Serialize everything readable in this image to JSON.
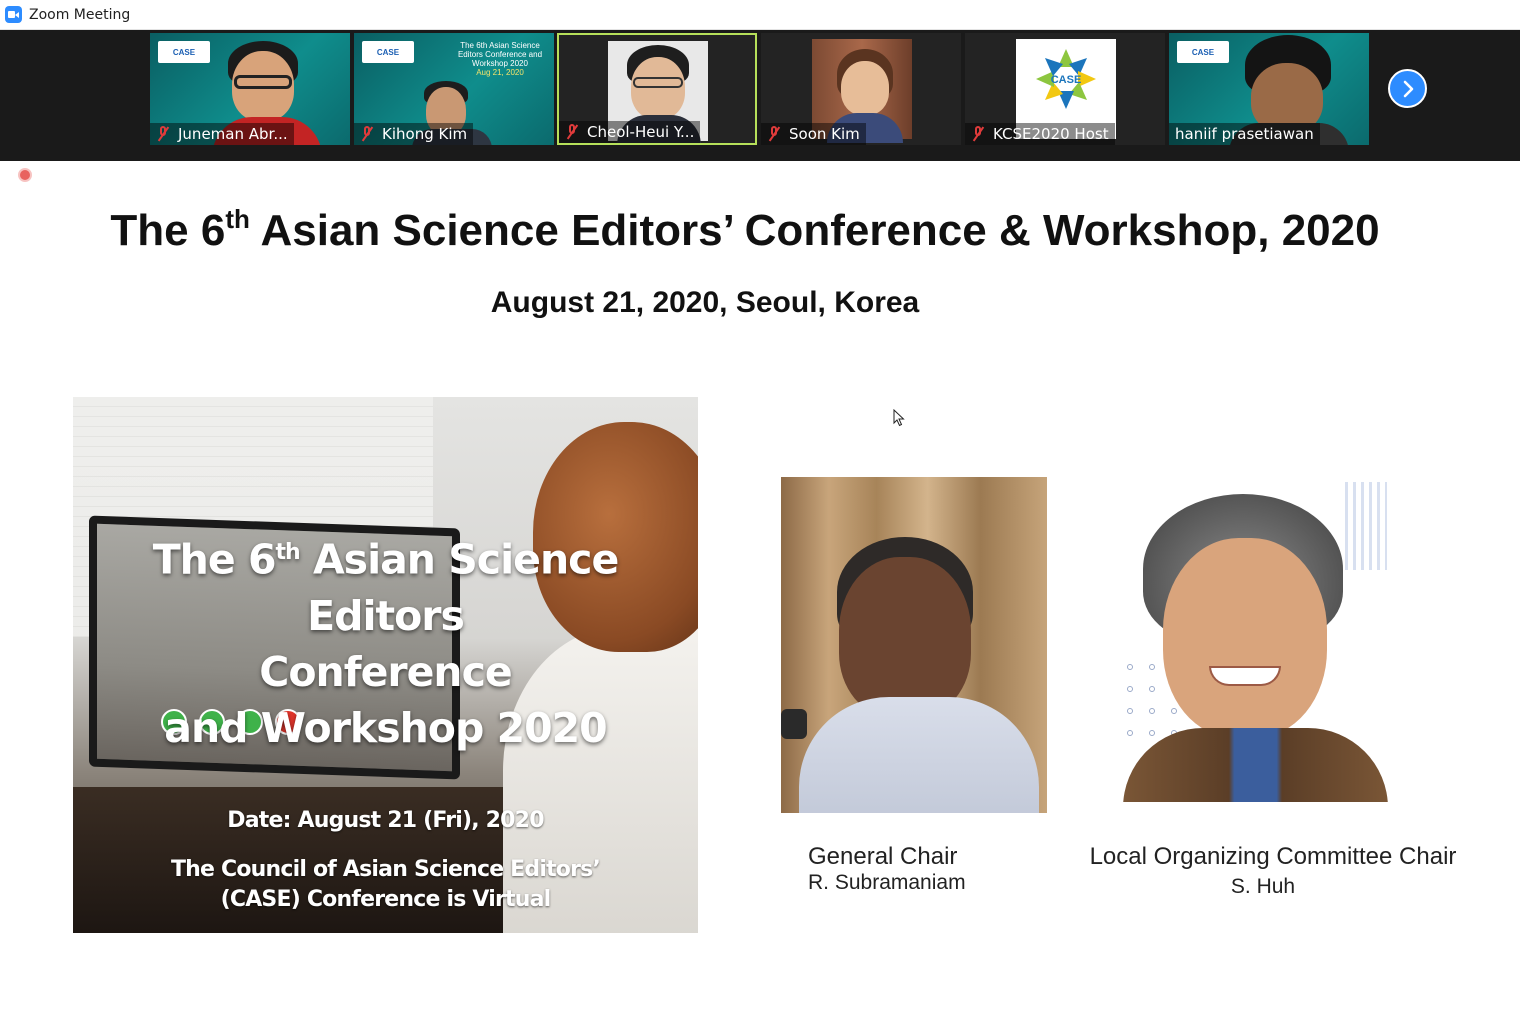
{
  "window": {
    "title": "Zoom Meeting"
  },
  "participants": [
    {
      "name": "Juneman Abr...",
      "muted": true,
      "active": false
    },
    {
      "name": "Kihong Kim",
      "muted": true,
      "active": false
    },
    {
      "name": "Cheol-Heui Y...",
      "muted": true,
      "active": true
    },
    {
      "name": "Soon Kim",
      "muted": true,
      "active": false
    },
    {
      "name": "KCSE2020 Host",
      "muted": true,
      "active": false
    },
    {
      "name": "haniif prasetiawan",
      "muted": false,
      "active": false
    }
  ],
  "thumb_text": {
    "case_logo": "CASE",
    "kihong_slide_title": "The 6th Asian Science Editors Conference and Workshop 2020",
    "kihong_slide_date": "Aug 21, 2020"
  },
  "slide": {
    "title_main": "The 6",
    "title_sup": "th",
    "title_rest": " Asian Science Editors’ Conference & Workshop, 2020",
    "subtitle": "August 21, 2020, Seoul, Korea",
    "poster": {
      "heading_line1_a": "The 6",
      "heading_line1_sup": "th",
      "heading_line1_b": " Asian Science Editors",
      "heading_line2": "Conference",
      "heading_line3": "and Workshop 2020",
      "date": "Date: August 21 (Fri), 2020",
      "footer_line1": "The Council of Asian Science Editors’",
      "footer_line2": "(CASE) Conference is Virtual"
    },
    "general_chair": {
      "role": "General Chair",
      "name": "R. Subramaniam"
    },
    "local_chair": {
      "role": "Local Organizing Committee Chair",
      "name": "S. Huh"
    }
  },
  "colors": {
    "zoom_blue": "#2d8cff",
    "active_border": "#b6e05a",
    "muted_red": "#e03b3b",
    "strip_bg": "#1a1a1a"
  },
  "icons": {
    "app": "zoom-camera-icon",
    "mic": "mic-muted-icon",
    "next": "chevron-right-icon",
    "record": "record-dot-icon",
    "cursor": "mouse-pointer-icon"
  }
}
